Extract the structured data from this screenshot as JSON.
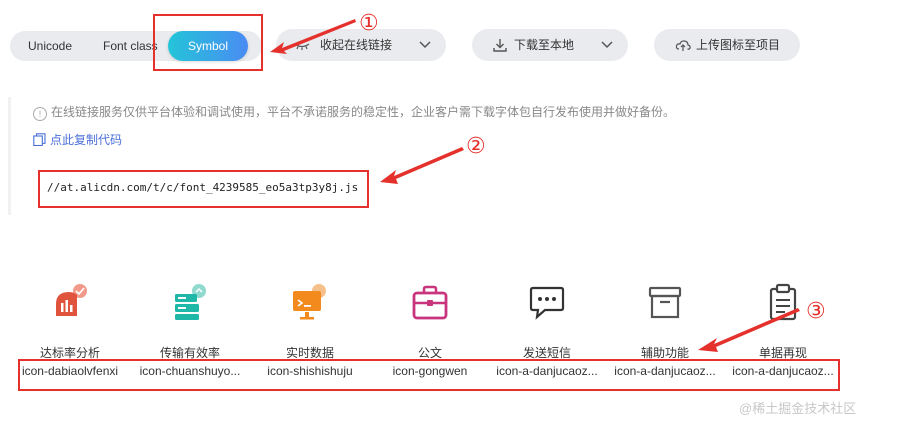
{
  "tabs": {
    "unicode": "Unicode",
    "fontclass": "Font class",
    "symbol": "Symbol"
  },
  "toolbar": {
    "collapse_label": "收起在线链接",
    "download_label": "下载至本地",
    "upload_label": "上传图标至项目"
  },
  "notice": {
    "text": "在线链接服务仅供平台体验和调试使用，平台不承诺服务的稳定性，企业客户需下载字体包自行发布使用并做好备份。"
  },
  "copy_code": "点此复制代码",
  "online_link": "//at.alicdn.com/t/c/font_4239585_eo5a3tp3y8j.js",
  "annotations": [
    "①",
    "②",
    "③"
  ],
  "icons": [
    {
      "name": "达标率分析",
      "code": "icon-dabiaolvfenxi",
      "glyph": "chart-gauge-icon",
      "color": "#e0533d"
    },
    {
      "name": "传输有效率",
      "code": "icon-chuanshuyo...",
      "glyph": "server-upload-icon",
      "color": "#1fb8a8"
    },
    {
      "name": "实时数据",
      "code": "icon-shishishuju",
      "glyph": "monitor-data-icon",
      "color": "#f28a1e"
    },
    {
      "name": "公文",
      "code": "icon-gongwen",
      "glyph": "briefcase-icon",
      "color": "#c8357d"
    },
    {
      "name": "发送短信",
      "code": "icon-a-danjucaoz...",
      "glyph": "message-icon",
      "color": "#333333"
    },
    {
      "name": "辅助功能",
      "code": "icon-a-danjucaoz...",
      "glyph": "archive-box-icon",
      "color": "#555555"
    },
    {
      "name": "单据再现",
      "code": "icon-a-danjucaoz...",
      "glyph": "clipboard-icon",
      "color": "#444444"
    }
  ],
  "watermark": "@稀土掘金技术社区",
  "colors": {
    "accent_red": "#e5312c",
    "symbol_gradient_start": "#24c4d8",
    "symbol_gradient_end": "#4a8cf3",
    "link_blue": "#4b6fd9"
  }
}
